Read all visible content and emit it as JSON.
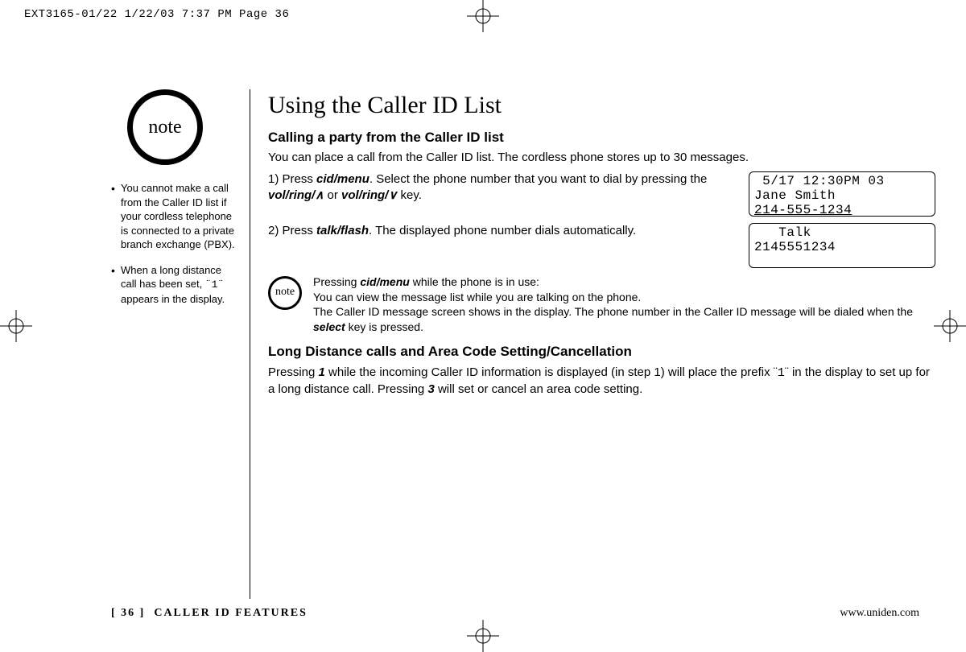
{
  "jobline": "EXT3165-01/22  1/22/03  7:37 PM  Page 36",
  "sidebar": {
    "note_label": "note",
    "items": [
      "You cannot make a call from the Caller ID list if your cordless telephone is connected to a private branch exchange (PBX).",
      "When a long distance call has been set, ¨1¨ appears in the display."
    ]
  },
  "main": {
    "title": "Using the Caller ID List",
    "section1": {
      "heading": "Calling a party from the Caller ID list",
      "intro": "You can place a call from the Caller ID list. The cordless phone stores up to 30 messages.",
      "step1_pre": "1) Press ",
      "step1_key1": "cid/menu",
      "step1_mid": ". Select the phone number that you want to dial by pressing the ",
      "step1_key2": "vol/ring/",
      "step1_or": " or ",
      "step1_key3": "vol/ring/",
      "step1_end": " key.",
      "step2_pre": "2) Press ",
      "step2_key": "talk/flash",
      "step2_end": ". The displayed phone number dials automatically.",
      "lcd1_line1": " 5/17 12:30PM 03",
      "lcd1_line2": "Jane Smith",
      "lcd1_line3": "214-555-1234",
      "lcd2_line1": "   Talk",
      "lcd2_line2": "2145551234",
      "note_small_label": "note",
      "note_small_l1_pre": "Pressing ",
      "note_small_l1_key": "cid/menu",
      "note_small_l1_post": " while the phone is in use:",
      "note_small_l2": "You can view the message list while you are talking on the phone.",
      "note_small_l3_pre": "The Caller ID message screen shows in the display. The phone number in the Caller ID message will be dialed when the ",
      "note_small_l3_key": "select",
      "note_small_l3_post": " key is pressed."
    },
    "section2": {
      "heading": "Long Distance calls and Area Code Setting/Cancellation",
      "p_pre": "Pressing ",
      "p_key1": "1",
      "p_mid1": " while the incoming Caller ID information is displayed (in step 1) will place the prefix ¨",
      "p_mono": "1",
      "p_mid2": "¨ in the display to set up for a long distance call. Pressing ",
      "p_key2": "3",
      "p_end": " will set or cancel an area code setting."
    }
  },
  "footer": {
    "page": "[ 36 ]",
    "section": "CALLER ID FEATURES",
    "url": "www.uniden.com"
  }
}
